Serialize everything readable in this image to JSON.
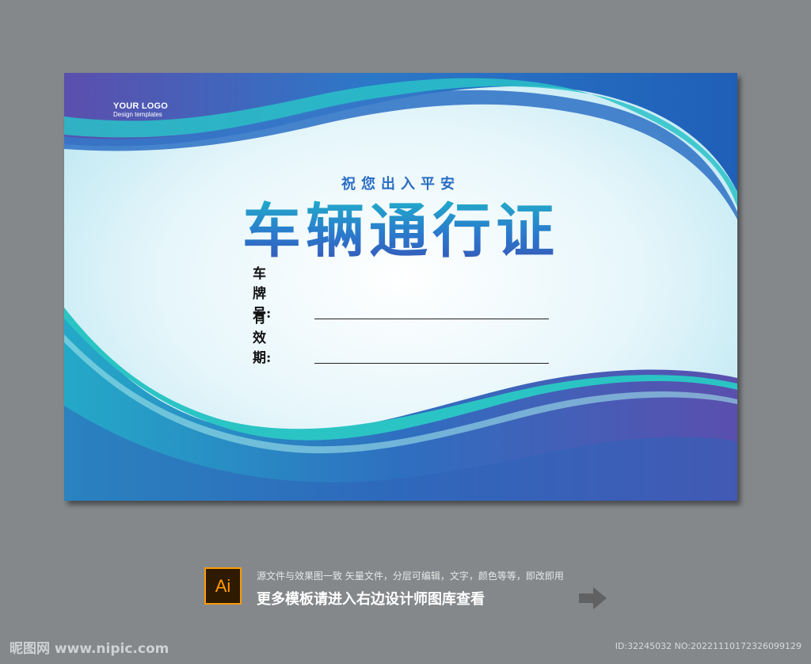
{
  "card": {
    "logo_main": "YOUR LOGO",
    "logo_sub": "Design templates",
    "subtitle": "祝您出入平安",
    "title": "车辆通行证",
    "fields": [
      {
        "label": "车牌号:"
      },
      {
        "label": "有效期:"
      }
    ]
  },
  "footer": {
    "app_icon_label": "Ai",
    "description": "源文件与效果图一致 矢量文件，分层可编辑，文字，颜色等等，即改即用",
    "cta": "更多模板请进入右边设计师图库查看"
  },
  "watermark": {
    "site": "昵图网 www.nipic.com",
    "id_text": "ID:32245032 NO:20221110172326099129"
  },
  "colors": {
    "background": "#85888b",
    "wave_blue": "#2b6fc2",
    "wave_teal": "#27c0c4",
    "wave_purple": "#5a4fae",
    "card_light": "#e9f7fb",
    "title_accent": "#2a6cc3"
  },
  "icons": [
    "adobe-illustrator-icon",
    "arrow-right-icon"
  ]
}
